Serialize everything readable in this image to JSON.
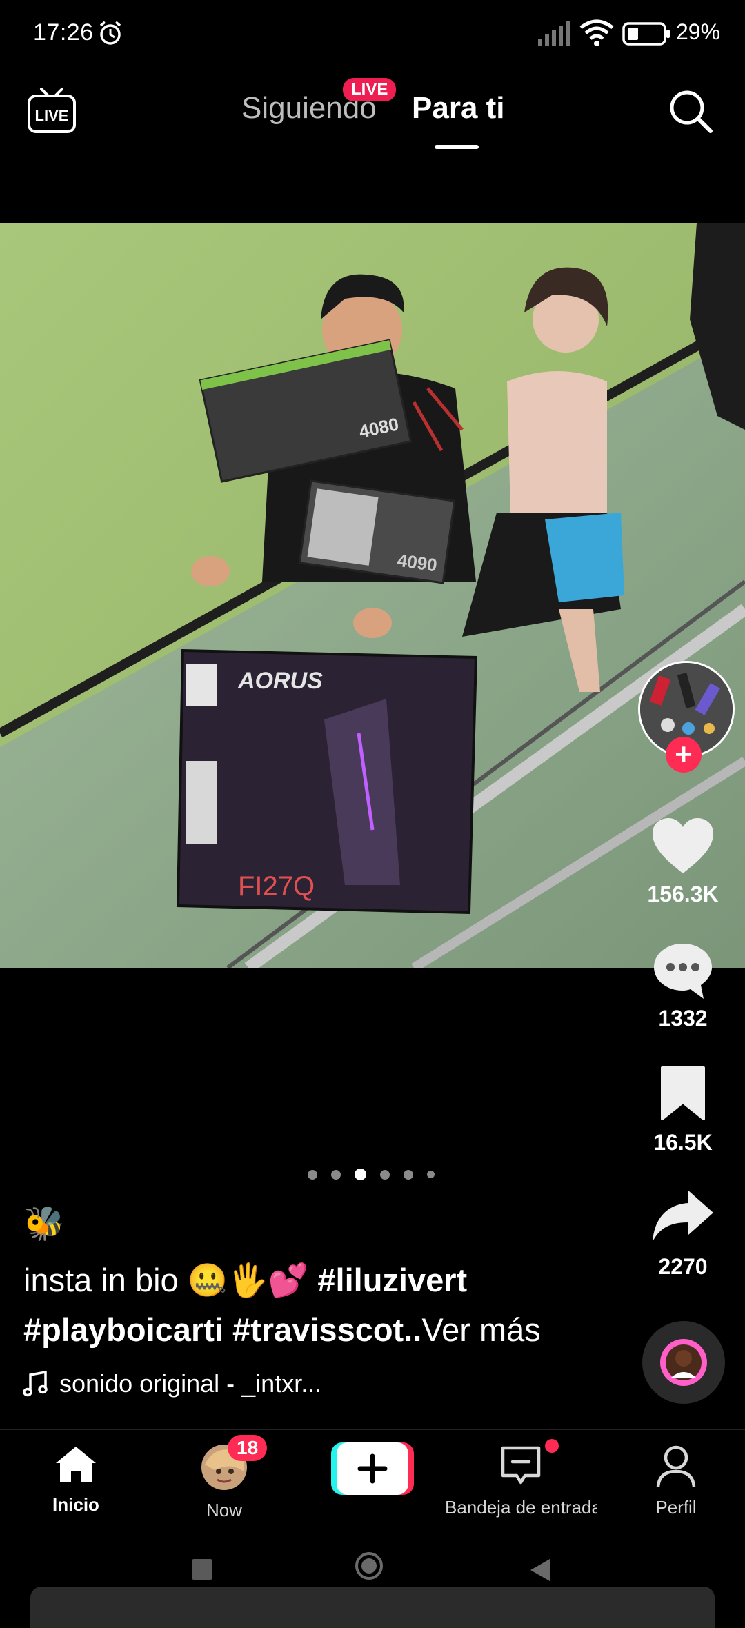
{
  "status_bar": {
    "time": "17:26",
    "battery": "29%"
  },
  "top_nav": {
    "tab_following": "Siguiendo",
    "live_badge": "LIVE",
    "tab_foryou": "Para ti",
    "live_icon_text": "LIVE"
  },
  "rail": {
    "likes": "156.3K",
    "comments": "1332",
    "saves": "16.5K",
    "shares": "2270"
  },
  "video": {
    "box_gpu_1": "4080",
    "box_gpu_2": "4090",
    "box_monitor_brand": "AORUS",
    "box_monitor_model": "FI27Q"
  },
  "pagination": {
    "count": 6,
    "active_index": 2
  },
  "caption": {
    "emoji_top": "🐝",
    "text_start": "insta in bio 🤐🖐💕 ",
    "tag1": "#liluzivert",
    "tag2": "#playboicarti",
    "tag3": "#travisscot",
    "ellipsis": "..",
    "more": "Ver más"
  },
  "sound": {
    "label": "sonido original - _intxr..."
  },
  "bottom_nav": {
    "home": "Inicio",
    "now": "Now",
    "now_badge": "18",
    "inbox": "Bandeja de entrada",
    "profile": "Perfil"
  }
}
